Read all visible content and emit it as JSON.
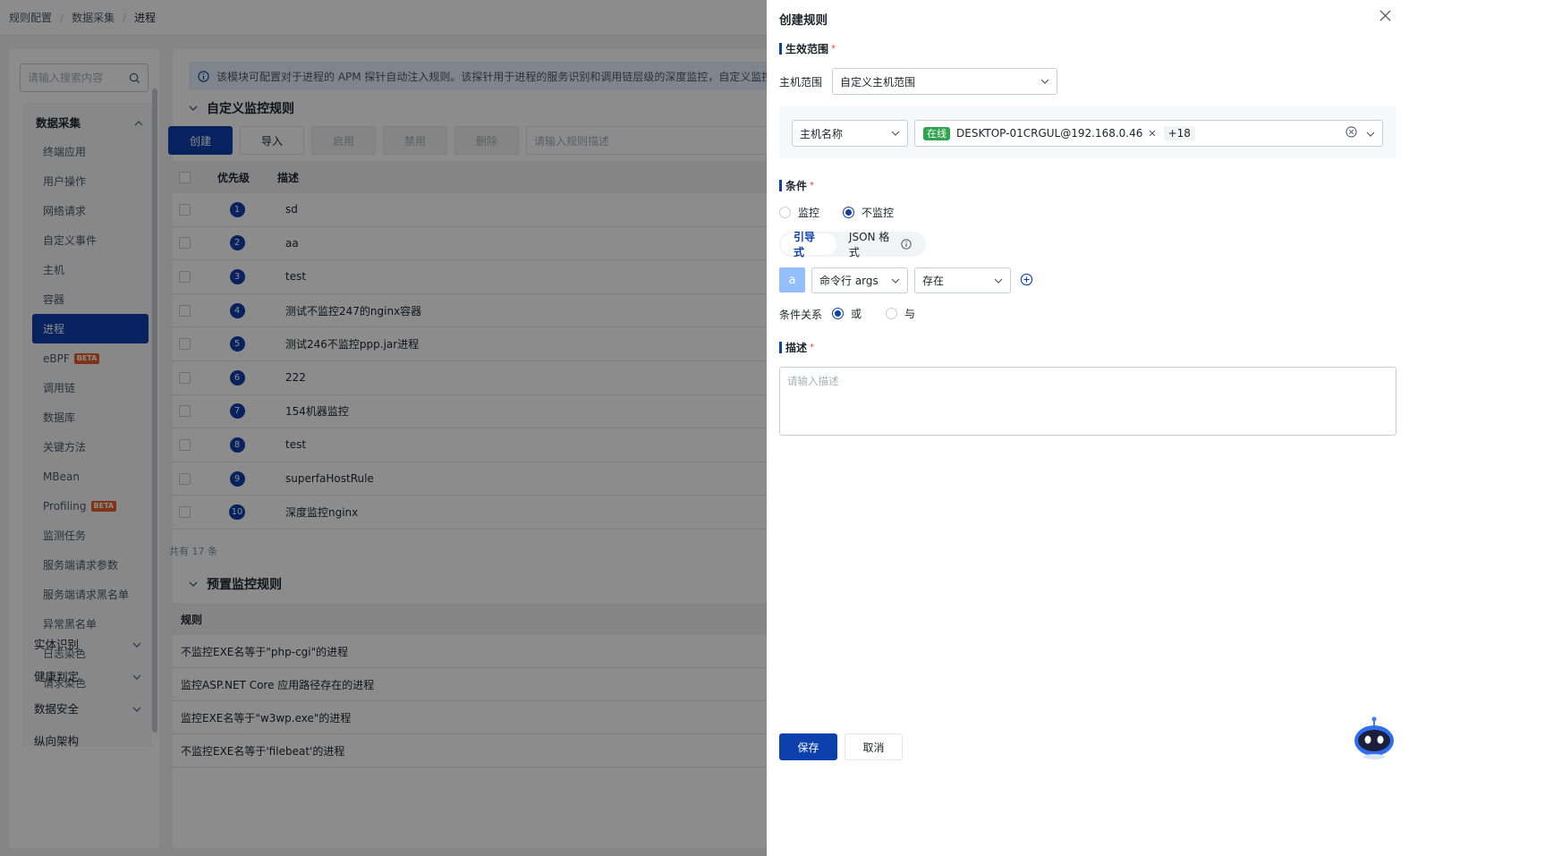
{
  "breadcrumb": [
    "规则配置",
    "数据采集",
    "进程"
  ],
  "sidebar": {
    "search_placeholder": "请输入搜索内容",
    "group_label": "数据采集",
    "items": [
      "终端应用",
      "用户操作",
      "网络请求",
      "自定义事件",
      "主机",
      "容器",
      "进程",
      "eBPF",
      "调用链",
      "数据库",
      "关键方法",
      "MBean",
      "Profiling",
      "监测任务",
      "服务端请求参数",
      "服务端请求黑名单",
      "异常黑名单",
      "日志染色",
      "请求染色"
    ],
    "active_item": "进程",
    "beta_badge": "BETA",
    "collapsed_groups": [
      "实体识别",
      "健康判定",
      "数据安全",
      "纵向架构"
    ]
  },
  "main": {
    "info_text": "该模块可配置对于进程的 APM 探针自动注入规则。该探针用于进程的服务识别和调用链层级的深度监控，自定义监控规则优先级",
    "custom_section_title": "自定义监控规则",
    "toolbar": {
      "create": "创建",
      "import": "导入",
      "enable": "启用",
      "disable": "禁用",
      "delete": "删除",
      "search_placeholder": "请输入规则描述"
    },
    "table_headers": {
      "priority": "优先级",
      "description": "描述"
    },
    "rules": [
      {
        "priority": "1",
        "description": "sd"
      },
      {
        "priority": "2",
        "description": "aa"
      },
      {
        "priority": "3",
        "description": "test"
      },
      {
        "priority": "4",
        "description": "测试不监控247的nginx容器"
      },
      {
        "priority": "5",
        "description": "测试246不监控ppp.jar进程"
      },
      {
        "priority": "6",
        "description": "222"
      },
      {
        "priority": "7",
        "description": "154机器监控"
      },
      {
        "priority": "8",
        "description": "test"
      },
      {
        "priority": "9",
        "description": "superfaHostRule"
      },
      {
        "priority": "10",
        "description": "深度监控nginx"
      }
    ],
    "total_text": "共有 17 条",
    "preset_section_title": "预置监控规则",
    "preset_header": "规则",
    "preset_rules": [
      "不监控EXE名等于\"php-cgi\"的进程",
      "监控ASP.NET Core 应用路径存在的进程",
      "监控EXE名等于\"w3wp.exe\"的进程",
      "不监控EXE名等于'filebeat'的进程"
    ]
  },
  "drawer": {
    "title": "创建规则",
    "scope_label": "生效范围",
    "host_scope_label": "主机范围",
    "host_scope_value": "自定义主机范围",
    "host_field_value": "主机名称",
    "online_tag": "在线",
    "host_tag": "DESKTOP-01CRGUL@192.168.0.46",
    "more_tag": "+18",
    "condition_label": "条件",
    "monitor_options": [
      "监控",
      "不监控"
    ],
    "monitor_selected": "不监控",
    "mode_tabs": [
      "引导式",
      "JSON 格式"
    ],
    "mode_selected": "引导式",
    "var_name": "a",
    "cond_field": "命令行 args",
    "cond_operator": "存在",
    "relation_label": "条件关系",
    "relation_options": [
      "或",
      "与"
    ],
    "relation_selected": "或",
    "desc_label": "描述",
    "desc_placeholder": "请输入描述",
    "save": "保存",
    "cancel": "取消",
    "required_mark": "*"
  },
  "colors": {
    "primary": "#0d3fad",
    "online": "#2fa34f",
    "danger": "#f53f3f",
    "info_bg": "#e8f3ff"
  }
}
